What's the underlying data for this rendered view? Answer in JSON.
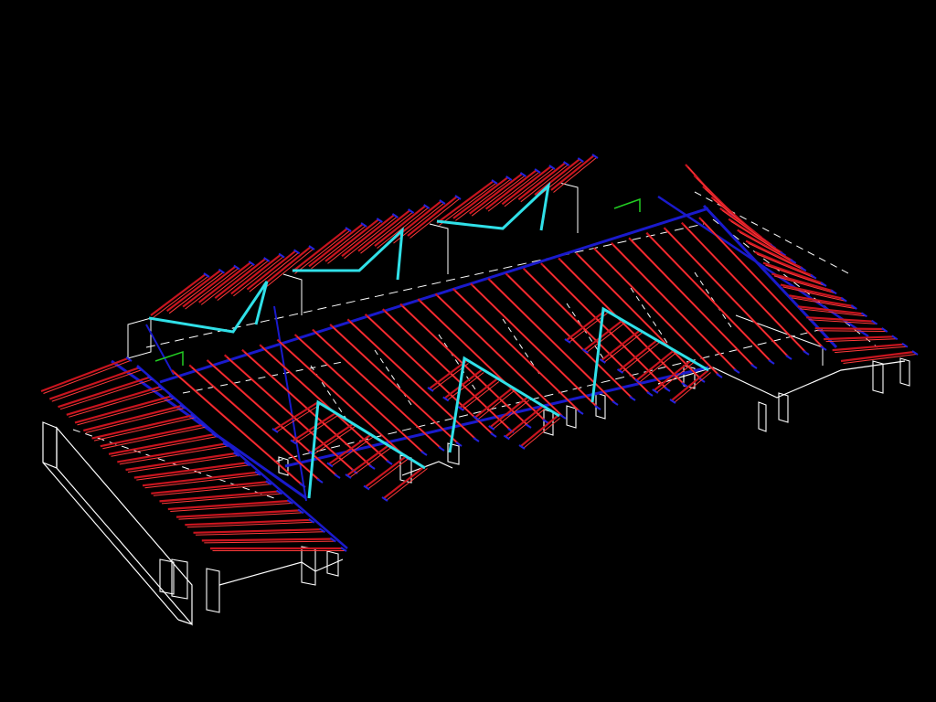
{
  "colors": {
    "background": "#000000",
    "rafter": "#c8141e",
    "rafter_edge": "#ff3a3a",
    "rafter_end": "#2222dd",
    "purlin": "#1a1acc",
    "hip_valley": "#30e0e8",
    "wall": "#ffffff",
    "hidden": "#ffffff",
    "marker": "#22cc22"
  }
}
